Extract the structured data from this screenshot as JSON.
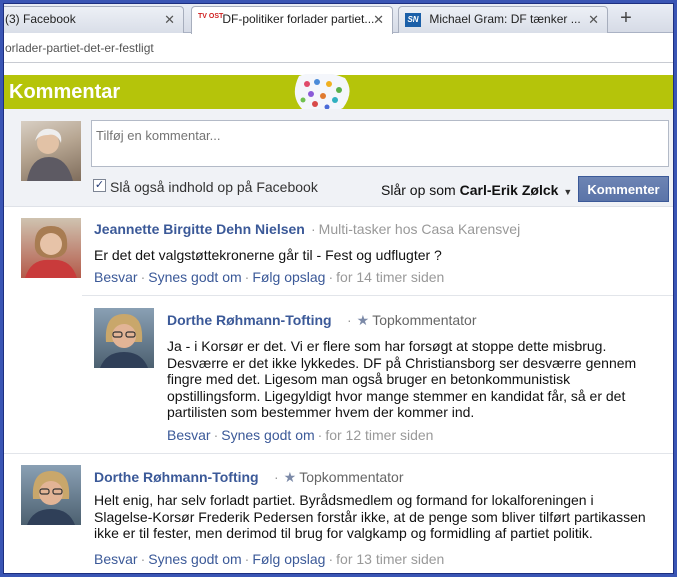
{
  "browser": {
    "tabs": [
      {
        "label": "(3) Facebook",
        "icon": "facebook-favicon"
      },
      {
        "label": "DF-politiker forlader partiet...",
        "icon": "tv2-ost-favicon",
        "favicon_text": "TV OST"
      },
      {
        "label": "Michael Gram: DF tænker ...",
        "icon": "sn-favicon",
        "favicon_text": "SN"
      }
    ],
    "url": "orlader-partiet-det-er-festligt"
  },
  "header": {
    "title": "Kommentar",
    "accent_color": "#b5c40a"
  },
  "composer": {
    "placeholder": "Tilføj en kommentar...",
    "also_post_label": "Slå også indhold op på Facebook",
    "also_post_checked": true,
    "posting_as_prefix": "Slår op som ",
    "posting_as_name": "Carl-Erik Zølck",
    "submit_label": "Kommenter"
  },
  "comments": [
    {
      "author": "Jeannette Birgitte Dehn Nielsen",
      "meta": "Multi-tasker hos Casa Karensvej",
      "body": "Er det det valgstøttekronerne går til - Fest og udflugter ?",
      "actions": [
        "Besvar",
        "Synes godt om",
        "Følg opslag"
      ],
      "time": "for 14 timer siden"
    },
    {
      "author": "Dorthe Røhmann-Tofting",
      "meta": "Topkommentator",
      "body": "Ja - i Korsør er det. Vi er flere som har forsøgt at stoppe dette misbrug. Desværre er det ikke lykkedes. DF på Christiansborg ser desværre gennem fingre med det. Ligesom man også bruger en betonkommunistisk opstillingsform. Ligegyldigt hvor mange stemmer en kandidat får, så er det partilisten som bestemmer hvem der kommer ind.",
      "actions": [
        "Besvar",
        "Synes godt om"
      ],
      "time": "for 12 timer siden"
    },
    {
      "author": "Dorthe Røhmann-Tofting",
      "meta": "Topkommentator",
      "body": "Helt enig, har selv forladt partiet. Byrådsmedlem og formand for lokalforeningen i Slagelse-Korsør Frederik Pedersen forstår ikke, at de penge som bliver tilført partikassen ikke er til fester, men derimod til brug for valgkamp og formidling af partiet politik.",
      "actions": [
        "Besvar",
        "Synes godt om",
        "Følg opslag"
      ],
      "time": "for 13 timer siden"
    }
  ]
}
